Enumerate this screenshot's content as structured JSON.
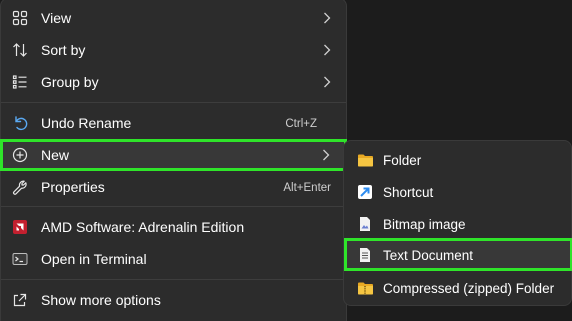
{
  "context_menu": {
    "items": [
      {
        "label": "View",
        "icon": "grid-view-icon"
      },
      {
        "label": "Sort by",
        "icon": "sort-arrows-icon"
      },
      {
        "label": "Group by",
        "icon": "group-list-icon"
      },
      {
        "label": "Undo Rename",
        "icon": "undo-icon",
        "shortcut": "Ctrl+Z"
      },
      {
        "label": "New",
        "icon": "plus-circle-icon"
      },
      {
        "label": "Properties",
        "icon": "wrench-icon",
        "shortcut": "Alt+Enter"
      },
      {
        "label": "AMD Software: Adrenalin Edition",
        "icon": "amd-icon"
      },
      {
        "label": "Open in Terminal",
        "icon": "terminal-icon"
      },
      {
        "label": "Show more options",
        "icon": "share-icon"
      }
    ]
  },
  "new_submenu": {
    "items": [
      {
        "label": "Folder",
        "icon": "folder-icon"
      },
      {
        "label": "Shortcut",
        "icon": "shortcut-icon"
      },
      {
        "label": "Bitmap image",
        "icon": "bitmap-icon"
      },
      {
        "label": "Text Document",
        "icon": "text-document-icon"
      },
      {
        "label": "Compressed (zipped) Folder",
        "icon": "zip-folder-icon"
      }
    ]
  },
  "colors": {
    "menu_bg": "#2c2c2c",
    "highlight_outline": "#2fe42a",
    "folder": "#f5c542",
    "shortcut": "#2d8cf0",
    "amd": "#c3202f"
  }
}
